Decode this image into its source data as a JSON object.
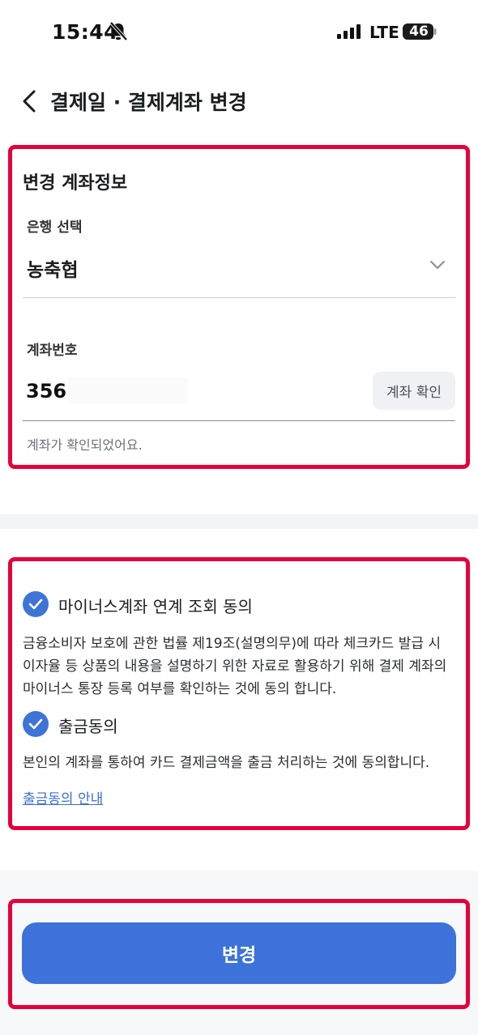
{
  "status_bar": {
    "time": "15:44",
    "network": "LTE",
    "battery": "46"
  },
  "header": {
    "title": "결제일 · 결제계좌 변경"
  },
  "account_section": {
    "title": "변경 계좌정보",
    "bank_label": "은행 선택",
    "bank_value": "농축협",
    "account_label": "계좌번호",
    "account_value": "356",
    "verify_button": "계좌 확인",
    "verified_message": "계좌가 확인되었어요."
  },
  "consent_section": {
    "minus_title": "마이너스계좌 연계 조회 동의",
    "minus_body": "금융소비자 보호에 관한 법률 제19조(설명의무)에 따라 체크카드 발급 시 이자율 등 상품의 내용을 설명하기 위한 자료로 활용하기 위해 결제 계좌의 마이너스 통장 등록 여부를 확인하는 것에 동의 합니다.",
    "minus_checked": true,
    "withdraw_title": "출금동의",
    "withdraw_body": "본인의 계좌를 통하여 카드 결제금액을 출금 처리하는 것에 동의합니다.",
    "withdraw_checked": true,
    "guide_link": "출금동의 안내"
  },
  "footer": {
    "submit_label": "변경"
  },
  "colors": {
    "accent": "#3c72d9",
    "highlight": "#e6003a"
  }
}
